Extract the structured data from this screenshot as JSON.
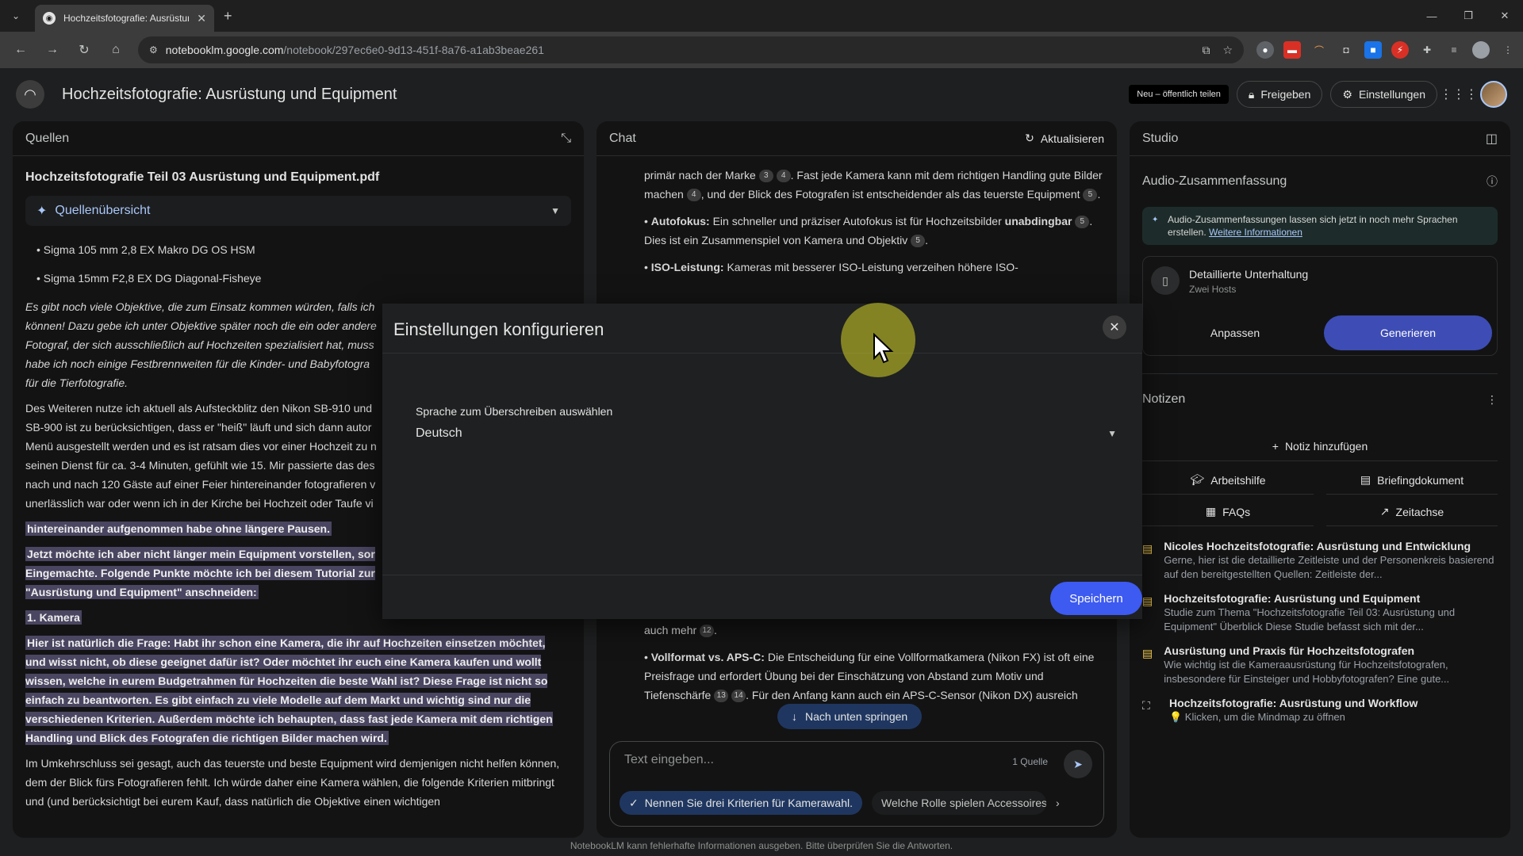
{
  "browser": {
    "tab_title": "Hochzeitsfotografie: Ausrüstung",
    "url_host": "notebooklm.google.com",
    "url_path": "/notebook/297ec6e0-9d13-451f-8a76-a1ab3beae261"
  },
  "header": {
    "title": "Hochzeitsfotografie: Ausrüstung und Equipment",
    "new_badge": "Neu – öffentlich teilen",
    "share_label": "Freigeben",
    "settings_label": "Einstellungen"
  },
  "sources": {
    "panel_title": "Quellen",
    "doc_name": "Hochzeitsfotografie Teil 03 Ausrüstung und Equipment.pdf",
    "overview_label": "Quellenübersicht",
    "bullets": [
      "Sigma 105 mm 2,8 EX Makro DG OS HSM",
      "Sigma 15mm F2,8 EX DG Diagonal-Fisheye"
    ],
    "para_italic": "Es gibt noch viele Objektive, die zum Einsatz kommen würden, falls ich können! Dazu gebe ich unter Objektive später noch die ein oder andere Fotograf, der sich ausschließlich auf Hochzeiten spezialisiert hat, muss habe ich noch einige Festbrennweiten für die Kinder- und Babyfotogra für die Tierfotografie.",
    "para2": "Des Weiteren nutze ich aktuell als Aufsteckblitz den Nikon SB-910 und SB-900 ist zu berücksichtigen, dass er \"heiß\" läuft und sich dann autor Menü ausgestellt werden und es ist ratsam dies vor einer Hochzeit zu n seinen Dienst für ca. 3-4 Minuten, gefühlt wie 15. Mir passierte das des nach und nach 120 Gäste auf einer Feier hintereinander fotografieren v unerlässlich war oder wenn ich in der Kirche bei Hochzeit oder Taufe vi",
    "hl1": "hintereinander aufgenommen habe ohne längere Pausen.",
    "hl2": "Jetzt möchte ich aber nicht länger mein Equipment vorstellen, sor Eingemachte. Folgende Punkte möchte ich bei diesem Tutorial zur \"Ausrüstung und Equipment\" anschneiden:",
    "hl3": "1. Kamera",
    "hl4": "Hier ist natürlich die Frage: Habt ihr schon eine Kamera, die ihr auf Hochzeiten einsetzen möchtet, und wisst nicht, ob diese geeignet dafür ist? Oder möchtet ihr euch eine Kamera kaufen und wollt wissen, welche in eurem Budgetrahmen für Hochzeiten die beste Wahl ist? Diese Frage ist nicht so einfach zu beantworten. Es gibt einfach zu viele Modelle auf dem Markt und wichtig sind nur die verschiedenen Kriterien. Außerdem möchte ich behaupten, dass fast jede Kamera mit dem richtigen Handling und Blick des Fotografen die richtigen Bilder machen wird.",
    "para3": "Im Umkehrschluss sei gesagt, auch das teuerste und beste Equipment wird demjenigen nicht helfen können, dem der Blick fürs Fotografieren fehlt. Ich würde daher eine Kamera wählen, die folgende Kriterien mitbringt und (und berücksichtigt bei eurem Kauf, dass natürlich die Objektive einen wichtigen"
  },
  "chat": {
    "panel_title": "Chat",
    "refresh_label": "Aktualisieren",
    "line1a": "primär nach der Marke",
    "line1b": ". Fast jede Kamera kann mit dem richtigen Handling gute Bilder machen",
    "line1c": ", und der Blick des Fotografen ist entscheidender als das teuerste Equipment",
    "af_title": "Autofokus:",
    "af_text": "Ein schneller und präziser Autofokus ist für Hochzeitsbilder",
    "af_bold": "unabdingbar",
    "af_text2": ". Dies ist ein Zusammenspiel von Kamera und Objektiv",
    "iso_title": "ISO-Leistung:",
    "iso_text": "Kameras mit besserer ISO-Leistung verzeihen höhere ISO-",
    "lower1": "auch mehr",
    "vf_title": "Vollformat vs. APS-C:",
    "vf_text": "Die Entscheidung für eine Vollformatkamera (Nikon FX) ist oft eine Preisfrage und erfordert Übung bei der Einschätzung von Abstand zum Motiv und Tiefenschärfe",
    "vf_text2": ". Für den Anfang kann auch ein APS-C-Sensor (Nikon DX) ausreich",
    "jump_label": "Nach unten springen",
    "input_placeholder": "Text eingeben...",
    "source_count": "1 Quelle",
    "suggestion1": "Nennen Sie drei Kriterien für Kamerawahl.",
    "suggestion2": "Welche Rolle spielen Accessoires?",
    "chips": [
      "3",
      "4",
      "4",
      "5",
      "5",
      "5",
      "12",
      "13",
      "14"
    ]
  },
  "studio": {
    "panel_title": "Studio",
    "audio_title": "Audio-Zusammenfassung",
    "notice_text": "Audio-Zusammenfassungen lassen sich jetzt in noch mehr Sprachen erstellen.",
    "notice_link": "Weitere Informationen",
    "card_title": "Detaillierte Unterhaltung",
    "card_sub": "Zwei Hosts",
    "customize_label": "Anpassen",
    "generate_label": "Generieren",
    "notes_title": "Notizen",
    "add_note_label": "Notiz hinzufügen",
    "quick": [
      "Arbeitshilfe",
      "Briefingdokument",
      "FAQs",
      "Zeitachse"
    ],
    "notes": [
      {
        "title": "Nicoles Hochzeitsfotografie: Ausrüstung und Entwicklung",
        "desc": "Gerne, hier ist die detaillierte Zeitleiste und der Personenkreis basierend auf den bereitgestellten Quellen: Zeitleiste der..."
      },
      {
        "title": "Hochzeitsfotografie: Ausrüstung und Equipment",
        "desc": "Studie zum Thema \"Hochzeitsfotografie Teil 03: Ausrüstung und Equipment\" Überblick Diese Studie befasst sich mit der..."
      },
      {
        "title": "Ausrüstung und Praxis für Hochzeitsfotografen",
        "desc": "Wie wichtig ist die Kameraausrüstung für Hochzeitsfotografen, insbesondere für Einsteiger und Hobbyfotografen? Eine gute..."
      },
      {
        "title": "Hochzeitsfotografie: Ausrüstung und Workflow",
        "desc": "💡 Klicken, um die Mindmap zu öffnen"
      }
    ]
  },
  "modal": {
    "title": "Einstellungen konfigurieren",
    "language_label": "Sprache zum Überschreiben auswählen",
    "language_value": "Deutsch",
    "save_label": "Speichern"
  },
  "footer": "NotebookLM kann fehlerhafte Informationen ausgeben. Bitte überprüfen Sie die Antworten."
}
